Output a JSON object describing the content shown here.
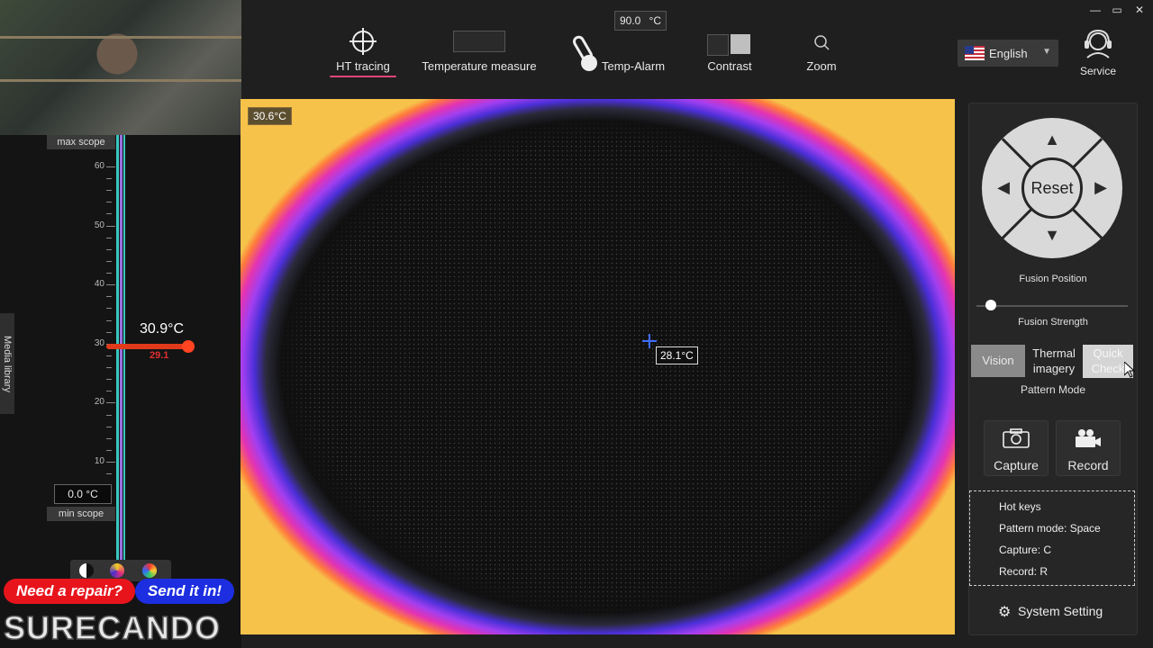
{
  "toolbar": {
    "ht_tracing": "HT tracing",
    "temperature_measure": "Temperature measure",
    "temp_alarm": "Temp-Alarm",
    "alarm_value": "90.0",
    "alarm_unit": "°C",
    "contrast": "Contrast",
    "zoom": "Zoom"
  },
  "window": {
    "minimize": "—",
    "maximize": "▭",
    "close": "✕"
  },
  "language": {
    "selected": "English"
  },
  "service": {
    "label": "Service"
  },
  "left": {
    "max_scope": "max scope",
    "min_scope": "min scope",
    "ticks": [
      "60",
      "50",
      "40",
      "30",
      "20",
      "10"
    ],
    "current_temp": "30.9°C",
    "min_marker": "29.1",
    "min_value": "0.0 °C",
    "media_library": "Media library",
    "palette_label": "palette"
  },
  "overlay": {
    "need_repair": "Need a repair?",
    "send_it_in": "Send it in!",
    "logo": "SURECANDO"
  },
  "thermal": {
    "max_temp": "30.6°C",
    "center_temp": "28.1°C"
  },
  "right": {
    "reset": "Reset",
    "fusion_position": "Fusion Position",
    "fusion_strength": "Fusion Strength",
    "fusion_strength_level": 0.06,
    "mode_vision": "Vision",
    "mode_thermal_1": "Thermal",
    "mode_thermal_2": "imagery",
    "mode_quick_1": "Quick",
    "mode_quick_2": "Check",
    "pattern_mode": "Pattern Mode",
    "capture": "Capture",
    "record": "Record",
    "hotkeys_title": "Hot keys",
    "hotkey_pattern": "Pattern mode: Space",
    "hotkey_capture": "Capture: C",
    "hotkey_record": "Record: R",
    "system_setting": "System Setting"
  },
  "colors": {
    "accent": "#e0457a",
    "cross": "#3c6cff",
    "min_marker": "#e03030"
  }
}
